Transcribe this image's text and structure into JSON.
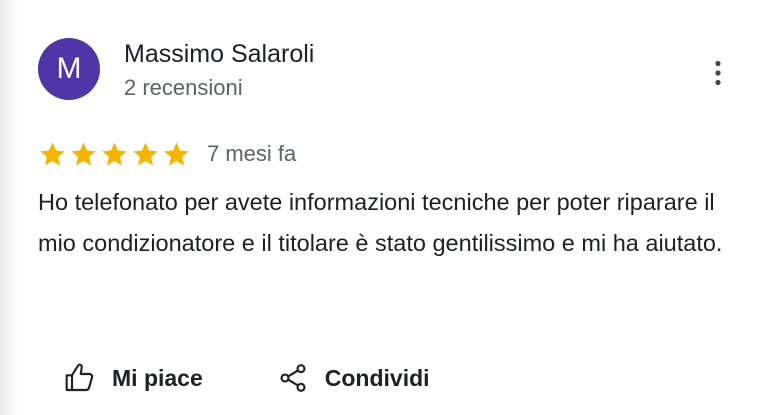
{
  "author": {
    "initial": "M",
    "name": "Massimo Salaroli",
    "reviews_count": "2 recensioni",
    "avatar_color": "#4f35a8"
  },
  "review": {
    "rating": 5,
    "rating_max": 5,
    "date": "7 mesi fa",
    "text": "Ho telefonato per avete informazioni tecniche per poter riparare il mio condizionatore e il titolare è stato gentilissimo e mi ha aiutato."
  },
  "actions": {
    "like_label": "Mi piace",
    "share_label": "Condividi"
  },
  "icons": {
    "more": "more-vert-icon",
    "star": "star-icon",
    "like": "thumb-up-icon",
    "share": "share-icon"
  },
  "colors": {
    "star": "#f4b400",
    "text": "#202124",
    "secondary_text": "#5f6368"
  }
}
